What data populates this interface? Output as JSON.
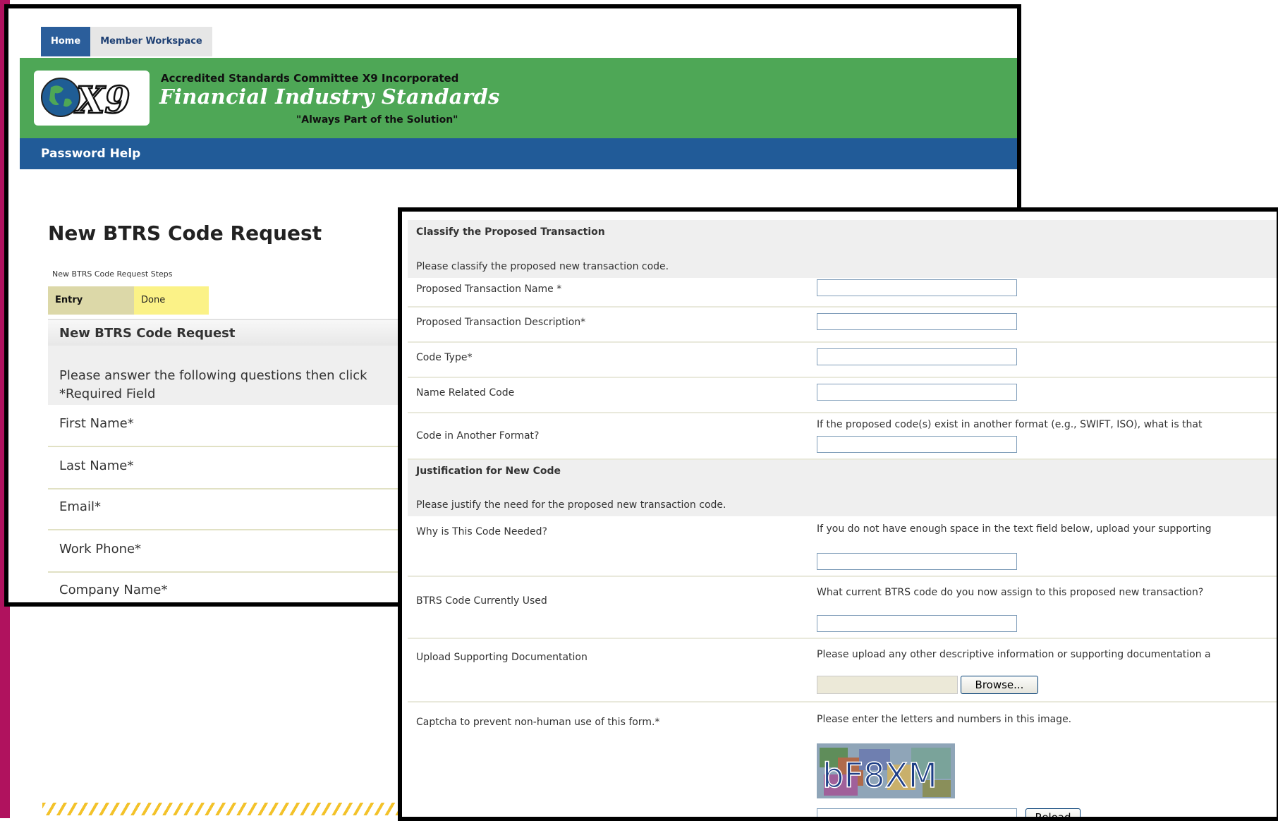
{
  "back_window": {
    "tabs": {
      "home": "Home",
      "member_workspace": "Member Workspace"
    },
    "header": {
      "org_name": "Accredited Standards Committee X9 Incorporated",
      "title": "Financial Industry Standards",
      "tagline": "\"Always Part of the Solution\"",
      "logo_text": "X9"
    },
    "nav_bar": {
      "password_help": "Password Help"
    },
    "page_title": "New BTRS Code Request",
    "steps_caption": "New BTRS Code Request Steps",
    "steps": {
      "entry": "Entry",
      "done": "Done"
    },
    "section_title": "New BTRS Code Request",
    "intro_line1": "Please answer the following questions then click",
    "intro_line2": "*Required Field",
    "fields": {
      "first_name": "First Name*",
      "last_name": "Last Name*",
      "email": "Email*",
      "work_phone": "Work Phone*",
      "company_name": "Company Name*"
    }
  },
  "front_window": {
    "classify": {
      "title": "Classify the Proposed Transaction",
      "subtitle": "Please classify the proposed new transaction code.",
      "proposed_name": "Proposed Transaction Name *",
      "proposed_description": "Proposed Transaction Description*",
      "code_type": "Code Type*",
      "name_related_code": "Name Related Code",
      "code_another_format": "Code in Another Format?",
      "code_another_format_help": "If the proposed code(s) exist in another format (e.g., SWIFT, ISO), what is that"
    },
    "justification": {
      "title": "Justification for New Code",
      "subtitle": "Please justify the need for the proposed new transaction code.",
      "why_needed": "Why is This Code Needed?",
      "why_needed_help": "If you do not have enough space in the text field below, upload your supporting",
      "btrs_current": "BTRS Code Currently Used",
      "btrs_current_help": "What current BTRS code do you now assign to this proposed new transaction?",
      "upload_docs": "Upload Supporting Documentation",
      "upload_docs_help": "Please upload any other descriptive information or supporting documentation a",
      "browse_button": "Browse...",
      "captcha_label": "Captcha to prevent non-human use of this form.*",
      "captcha_help": "Please enter the letters and numbers in this image.",
      "captcha_text": "bF8XM",
      "reload_button": "Reload"
    }
  },
  "colors": {
    "header_green": "#4ea756",
    "nav_blue": "#215b98",
    "tab_home": "#2b5e9b",
    "step_entry": "#dcd8a8",
    "step_done": "#fbf287",
    "accent_magenta": "#b0125e"
  }
}
